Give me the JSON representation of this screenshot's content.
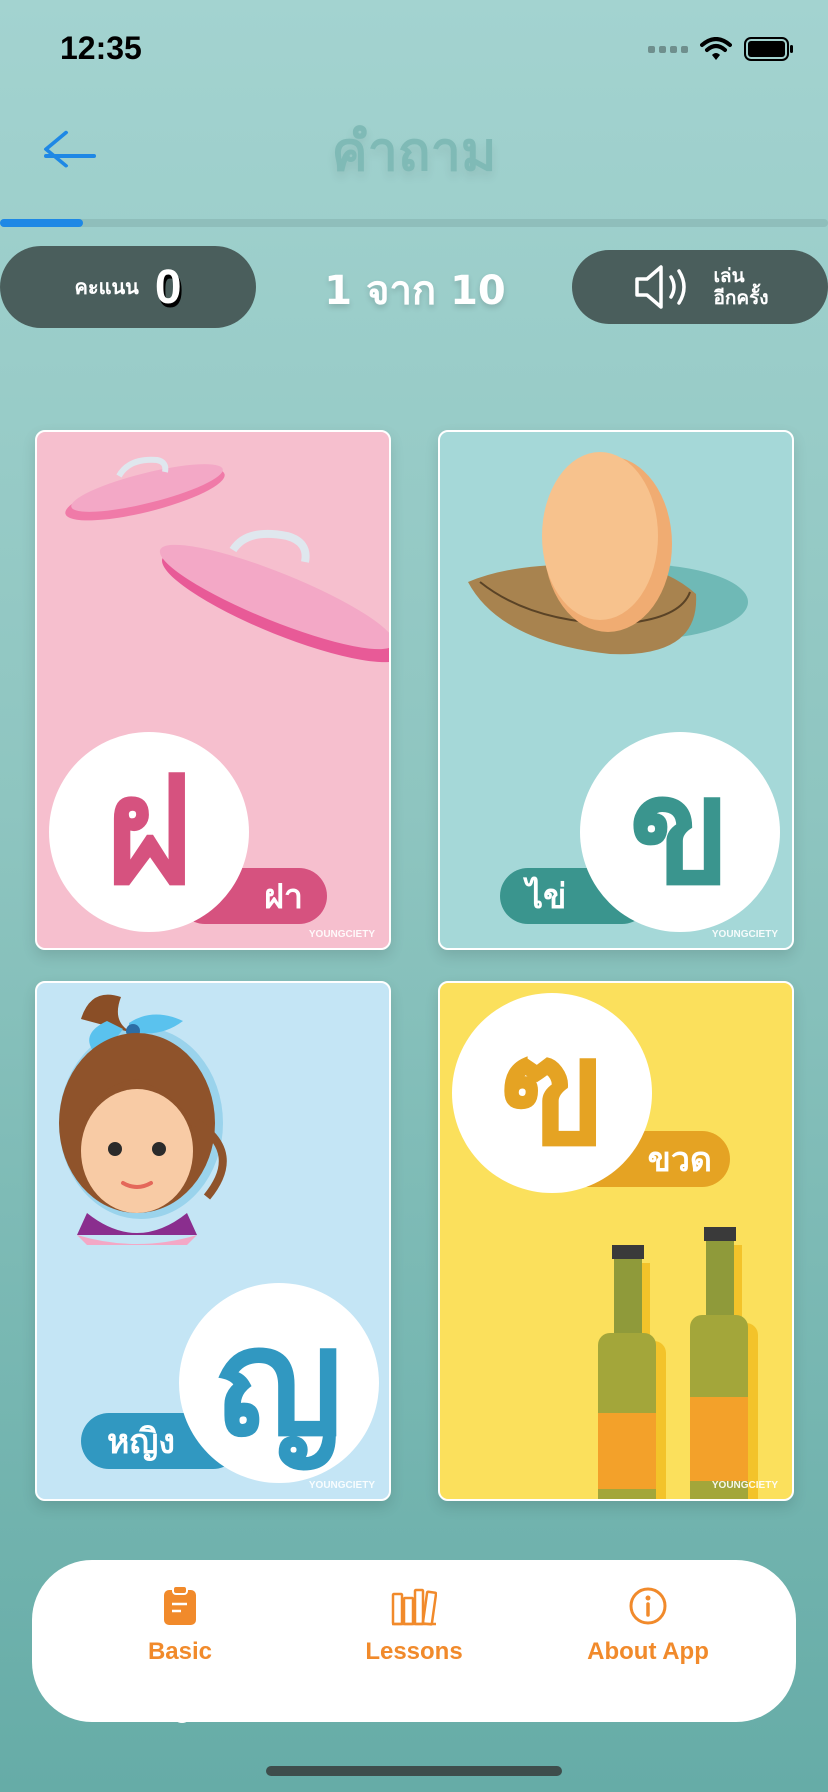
{
  "status_bar": {
    "time": "12:35",
    "icons": [
      "signal-dots-icon",
      "wifi-icon",
      "battery-icon"
    ]
  },
  "header": {
    "back_icon": "arrow-left-icon",
    "title": "คำถาม"
  },
  "progress": {
    "fraction": 0.1,
    "fill_color": "#1e88e5"
  },
  "score": {
    "label": "คะแนน",
    "value": "0"
  },
  "counter": {
    "text": "1 จาก 10"
  },
  "replay": {
    "icon": "speaker-icon",
    "line1": "เล่น",
    "line2": "อีกครั้ง"
  },
  "cards": [
    {
      "letter": "ฝ",
      "word": "ฝา",
      "brand": "YOUNGCIETY",
      "color": "#d6527f",
      "bg": "#f6bfce",
      "illustration": "iron-lids"
    },
    {
      "letter": "ข",
      "word": "ไข่",
      "brand": "YOUNGCIETY",
      "color": "#3a958e",
      "bg": "#a5d8d8",
      "illustration": "egg-in-nest"
    },
    {
      "letter": "ญ",
      "word": "หญิง",
      "brand": "YOUNGCIETY",
      "color": "#3198c1",
      "bg": "#c4e5f5",
      "illustration": "girl"
    },
    {
      "letter": "ฃ",
      "word": "ขวด",
      "brand": "YOUNGCIETY",
      "color": "#e5a323",
      "bg": "#fbe05c",
      "illustration": "bottles"
    }
  ],
  "tabs": [
    {
      "label": "Basic",
      "icon": "clipboard-icon",
      "active": true
    },
    {
      "label": "Lessons",
      "icon": "books-icon",
      "active": false
    },
    {
      "label": "About App",
      "icon": "info-icon",
      "active": false
    }
  ],
  "colors": {
    "accent": "#f18a2b",
    "pill_bg": "#4a5e5c"
  }
}
